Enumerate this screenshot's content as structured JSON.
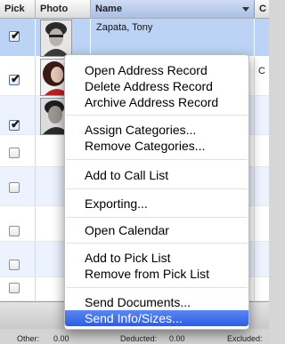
{
  "columns": {
    "pick": "Pick",
    "photo": "Photo",
    "name": "Name",
    "next": "C"
  },
  "rows": [
    {
      "checked": true,
      "name": "Zapata, Tony",
      "extra": "",
      "selected": true,
      "photo": "Photo 1"
    },
    {
      "checked": true,
      "name": "",
      "extra": "C",
      "selected": false,
      "photo": "Photo 2"
    },
    {
      "checked": true,
      "name": "",
      "extra": "",
      "selected": false,
      "photo": "Photo 3"
    },
    {
      "checked": false
    },
    {
      "checked": false
    },
    {
      "checked": false
    },
    {
      "checked": false
    },
    {
      "checked": false
    }
  ],
  "menu": {
    "items": [
      "Open Address Record",
      "Delete Address Record",
      "Archive Address Record",
      "Assign Categories...",
      "Remove Categories...",
      "Add to Call List",
      "Exporting...",
      "Open Calendar",
      "Add to Pick List",
      "Remove from Pick List",
      "Send Documents...",
      "Send Info/Sizes..."
    ],
    "highlighted_index": 11
  },
  "footer": {
    "other_label": "Other:",
    "other_value": "0.00",
    "deducted_label": "Deducted:",
    "deducted_value": "0.00",
    "excluded_label": "Excluded:"
  },
  "colors": {
    "selection": "#bcd3f6",
    "menu_highlight": "#3a6ee8"
  }
}
